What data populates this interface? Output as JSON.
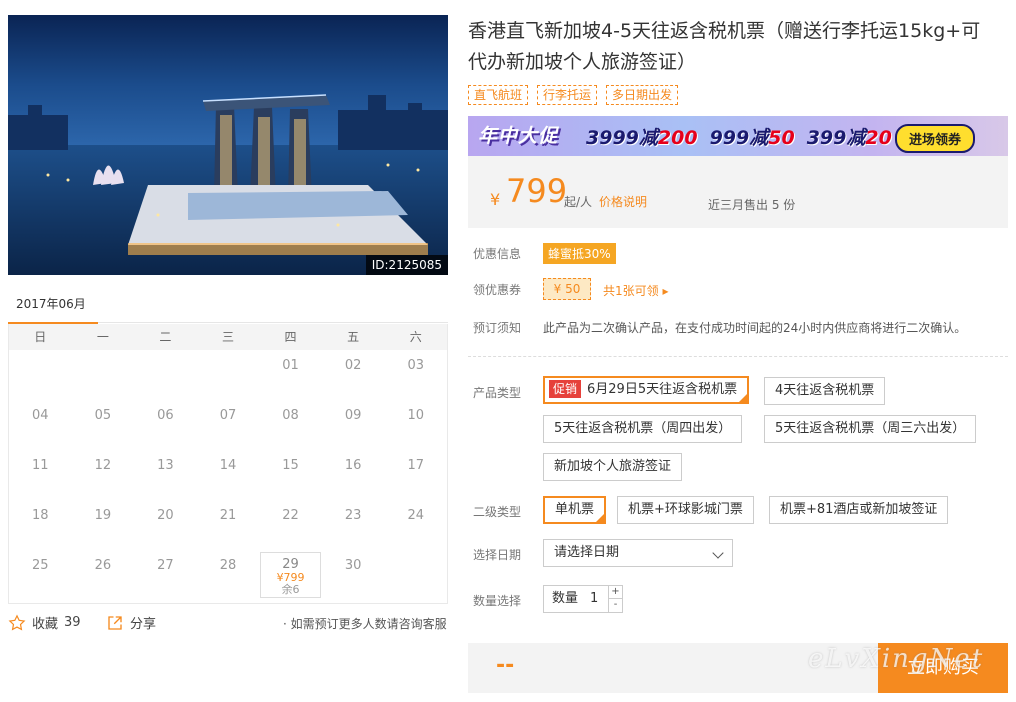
{
  "hero": {
    "image_id": "ID:2125085"
  },
  "calendar": {
    "month": "2017年06月",
    "weekdays": [
      "日",
      "一",
      "二",
      "三",
      "四",
      "五",
      "六"
    ],
    "lead_blanks": 4,
    "days": [
      "01",
      "02",
      "03",
      "04",
      "05",
      "06",
      "07",
      "08",
      "09",
      "10",
      "11",
      "12",
      "13",
      "14",
      "15",
      "16",
      "17",
      "18",
      "19",
      "20",
      "21",
      "22",
      "23",
      "24",
      "25",
      "26",
      "27",
      "28",
      "29",
      "30"
    ],
    "active_day": {
      "day": "29",
      "price": "¥799",
      "remain": "余6"
    }
  },
  "social": {
    "fav_label": "收藏",
    "fav_count": "39",
    "share_label": "分享",
    "consult": "· 如需预订更多人数请咨询客服"
  },
  "product": {
    "title": "香港直飞新加坡4-5天往返含税机票（赠送行李托运15kg+可代办新加坡个人旅游签证）",
    "tags": [
      "直飞航班",
      "行李托运",
      "多日期出发"
    ]
  },
  "banner": {
    "left": "年中大促",
    "deals": [
      {
        "base": "3999减",
        "off": "200"
      },
      {
        "base": "999减",
        "off": "50"
      },
      {
        "base": "399减",
        "off": "20"
      }
    ],
    "button": "进场领券"
  },
  "price": {
    "symbol": "¥",
    "value": "799",
    "unit": "起/人",
    "link": "价格说明",
    "sold": "近三月售出 5 份"
  },
  "info": {
    "promo_label": "优惠信息",
    "promo_badge": "蜂蜜抵30%",
    "coupon_label": "领优惠券",
    "coupon_value": "¥ 50",
    "coupon_link": "共1张可领 ▸",
    "notice_label": "预订须知",
    "notice_text": "此产品为二次确认产品，在支付成功时间起的24小时内供应商将进行二次确认。"
  },
  "product_type": {
    "label": "产品类型",
    "promo_tag": "促销",
    "options": [
      "6月29日5天往返含税机票",
      "4天往返含税机票",
      "5天往返含税机票（周四出发）",
      "5天往返含税机票（周三六出发）",
      "新加坡个人旅游签证"
    ]
  },
  "sub_type": {
    "label": "二级类型",
    "options": [
      "单机票",
      "机票+环球影城门票",
      "机票+81酒店或新加坡签证"
    ]
  },
  "date_select": {
    "label": "选择日期",
    "value": "请选择日期"
  },
  "quantity": {
    "label": "数量选择",
    "field_label": "数量",
    "value": "1",
    "plus": "+",
    "minus": "-"
  },
  "buy": {
    "total": "--",
    "button": "立即购买",
    "watermark": "eLvXingNet"
  },
  "colors": {
    "accent": "#f58a1f",
    "promo_red": "#e6413b"
  }
}
